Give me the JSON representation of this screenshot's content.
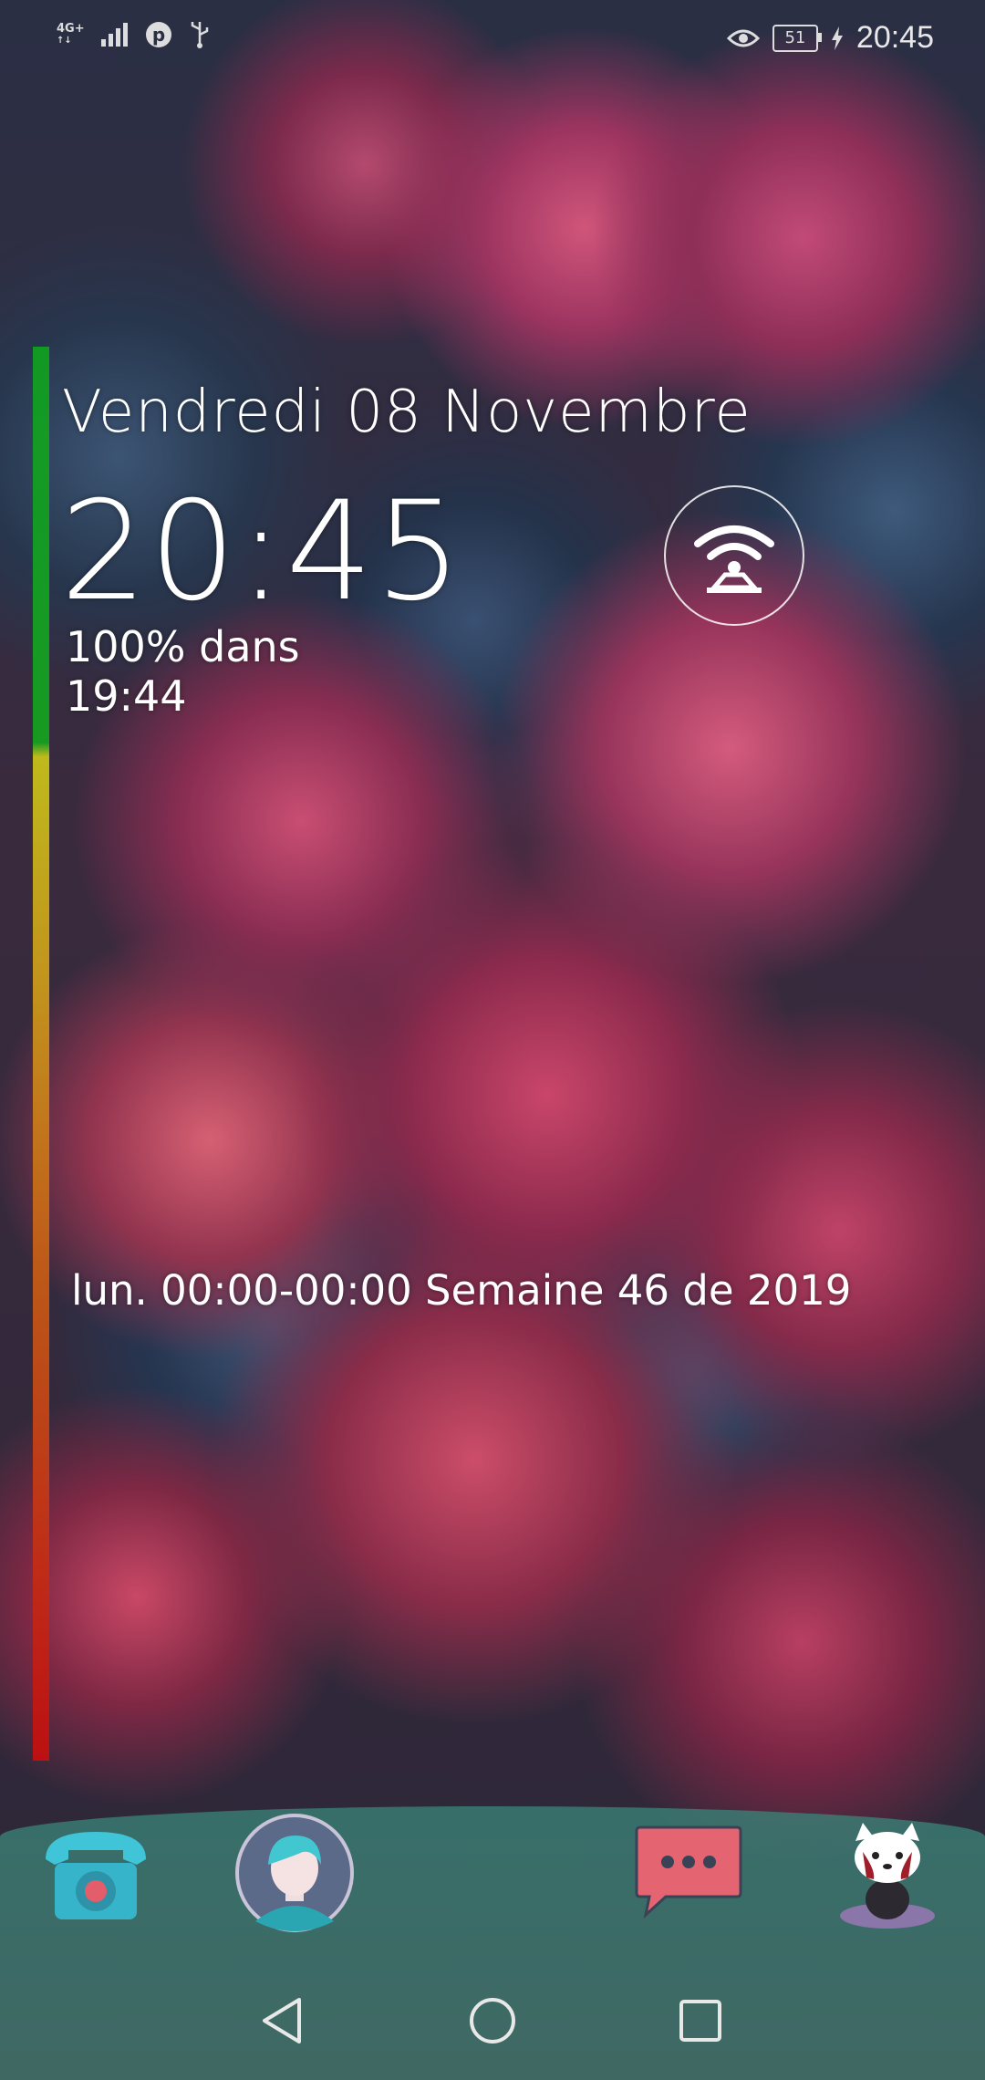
{
  "status_bar": {
    "network": "4G+",
    "signal_icon": "signal-bars-icon",
    "notification_icons": [
      "pinterest-icon",
      "usb-icon"
    ],
    "right_icons": [
      "eye-comfort-icon",
      "battery-icon",
      "charging-icon"
    ],
    "battery_level": "51",
    "time": "20:45"
  },
  "lock": {
    "date": "Vendredi 08 Novembre",
    "time": "20:45",
    "charge_line1": "100% dans",
    "charge_line2": "19:44",
    "week_line": "lun. 00:00-00:00 Semaine 46 de 2019",
    "wifi_icon": "wifi-hotspot-icon",
    "battery_bar_fraction": 1.0,
    "battery_bar_colors": [
      "#119e22",
      "#c6c11a",
      "#c45c17",
      "#c20f0f"
    ]
  },
  "dock": {
    "apps": [
      {
        "name": "phone",
        "icon": "telephone-icon"
      },
      {
        "name": "contacts",
        "icon": "person-avatar-icon"
      },
      {
        "name": "messages",
        "icon": "chat-bubble-icon"
      },
      {
        "name": "red-panda",
        "icon": "red-panda-icon"
      }
    ]
  },
  "nav": {
    "back_icon": "back-triangle-icon",
    "home_icon": "home-circle-icon",
    "recents_icon": "recents-square-icon"
  }
}
